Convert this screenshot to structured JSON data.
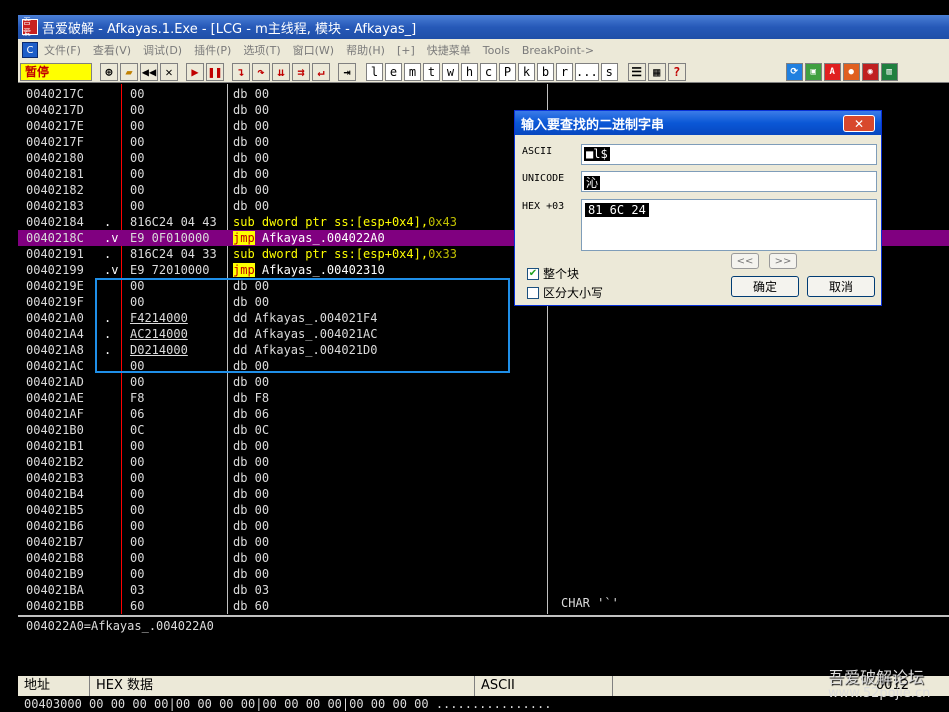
{
  "window": {
    "title": "吾爱破解 - Afkayas.1.Exe - [LCG - m主线程, 模块 - Afkayas_]",
    "logo_text": "吾爱"
  },
  "menu": {
    "app_icon": "C",
    "items": [
      "文件(F)",
      "查看(V)",
      "调试(D)",
      "插件(P)",
      "选项(T)",
      "窗口(W)",
      "帮助(H)",
      "[+]",
      "快捷菜单",
      "Tools",
      "BreakPoint->"
    ]
  },
  "toolbar": {
    "status": "暂停",
    "letters": [
      "l",
      "e",
      "m",
      "t",
      "w",
      "h",
      "c",
      "P",
      "k",
      "b",
      "r",
      "...",
      "s"
    ]
  },
  "cpu_rows": [
    {
      "addr": "0040217C",
      "mark": "",
      "hex": "00",
      "dis": "db 00"
    },
    {
      "addr": "0040217D",
      "mark": "",
      "hex": "00",
      "dis": "db 00"
    },
    {
      "addr": "0040217E",
      "mark": "",
      "hex": "00",
      "dis": "db 00"
    },
    {
      "addr": "0040217F",
      "mark": "",
      "hex": "00",
      "dis": "db 00"
    },
    {
      "addr": "00402180",
      "mark": "",
      "hex": "00",
      "dis": "db 00"
    },
    {
      "addr": "00402181",
      "mark": "",
      "hex": "00",
      "dis": "db 00"
    },
    {
      "addr": "00402182",
      "mark": "",
      "hex": "00",
      "dis": "db 00"
    },
    {
      "addr": "00402183",
      "mark": "",
      "hex": "00",
      "dis": "db 00"
    },
    {
      "addr": "00402184",
      "mark": ".",
      "hex": "816C24 04 43",
      "dis_kw": "sub",
      "dis_rest": " dword ptr ss:[esp+0x4],",
      "dis_num": "0x43"
    },
    {
      "addr": "0040218C",
      "mark": ".v",
      "hex": "E9 0F010000",
      "dis_jmp": "jmp",
      "dis_rest": " Afkayas_.004022A0",
      "highlight": true
    },
    {
      "addr": "00402191",
      "mark": ".",
      "hex": "816C24 04 33",
      "dis_kw": "sub",
      "dis_rest": " dword ptr ss:[esp+0x4],",
      "dis_num": "0x33"
    },
    {
      "addr": "00402199",
      "mark": ".v",
      "hex": "E9 72010000",
      "dis_jmp": "jmp",
      "dis_rest": " Afkayas_.00402310"
    },
    {
      "addr": "0040219E",
      "mark": "",
      "hex": "00",
      "dis": "db 00"
    },
    {
      "addr": "0040219F",
      "mark": "",
      "hex": "00",
      "dis": "db 00"
    },
    {
      "addr": "004021A0",
      "mark": ".",
      "hex": "F4214000",
      "dis": "dd Afkayas_.004021F4",
      "ul": true
    },
    {
      "addr": "004021A4",
      "mark": ".",
      "hex": "AC214000",
      "dis": "dd Afkayas_.004021AC",
      "ul": true
    },
    {
      "addr": "004021A8",
      "mark": ".",
      "hex": "D0214000",
      "dis": "dd Afkayas_.004021D0",
      "ul": true
    },
    {
      "addr": "004021AC",
      "mark": "",
      "hex": "00",
      "dis": "db 00"
    },
    {
      "addr": "004021AD",
      "mark": "",
      "hex": "00",
      "dis": "db 00"
    },
    {
      "addr": "004021AE",
      "mark": "",
      "hex": "F8",
      "dis": "db F8"
    },
    {
      "addr": "004021AF",
      "mark": "",
      "hex": "06",
      "dis": "db 06"
    },
    {
      "addr": "004021B0",
      "mark": "",
      "hex": "0C",
      "dis": "db 0C"
    },
    {
      "addr": "004021B1",
      "mark": "",
      "hex": "00",
      "dis": "db 00"
    },
    {
      "addr": "004021B2",
      "mark": "",
      "hex": "00",
      "dis": "db 00"
    },
    {
      "addr": "004021B3",
      "mark": "",
      "hex": "00",
      "dis": "db 00"
    },
    {
      "addr": "004021B4",
      "mark": "",
      "hex": "00",
      "dis": "db 00"
    },
    {
      "addr": "004021B5",
      "mark": "",
      "hex": "00",
      "dis": "db 00"
    },
    {
      "addr": "004021B6",
      "mark": "",
      "hex": "00",
      "dis": "db 00"
    },
    {
      "addr": "004021B7",
      "mark": "",
      "hex": "00",
      "dis": "db 00"
    },
    {
      "addr": "004021B8",
      "mark": "",
      "hex": "00",
      "dis": "db 00"
    },
    {
      "addr": "004021B9",
      "mark": "",
      "hex": "00",
      "dis": "db 00"
    },
    {
      "addr": "004021BA",
      "mark": "",
      "hex": "03",
      "dis": "db 03"
    },
    {
      "addr": "004021BB",
      "mark": "",
      "hex": "60",
      "dis": "db 60"
    }
  ],
  "char_line": "CHAR '`'",
  "info_line": "004022A0=Afkayas_.004022A0",
  "dump": {
    "col_addr": "地址",
    "col_hex": "HEX 数据",
    "col_ascii": "ASCII",
    "row_addr": "00403000",
    "row_hex": "00 00 00 00|00 00 00 00|00 00 00 00|00 00 00 00",
    "row_ascii": "................",
    "right_partial_1": "0012",
    "right_partial_2": "0012"
  },
  "watermark": {
    "line1": "吾爱破解论坛",
    "line2": "www.52pojie.cn"
  },
  "dialog": {
    "title": "输入要查找的二进制字串",
    "close": "✕",
    "ascii_label": "ASCII",
    "ascii_value": "■l$",
    "unicode_label": "UNICODE",
    "unicode_value": "沁",
    "hex_label": "HEX +03",
    "hex_value": "81 6C 24",
    "prev": "<<",
    "next": ">>",
    "chk_whole": "整个块",
    "chk_case": "区分大小写",
    "ok": "确定",
    "cancel": "取消"
  }
}
